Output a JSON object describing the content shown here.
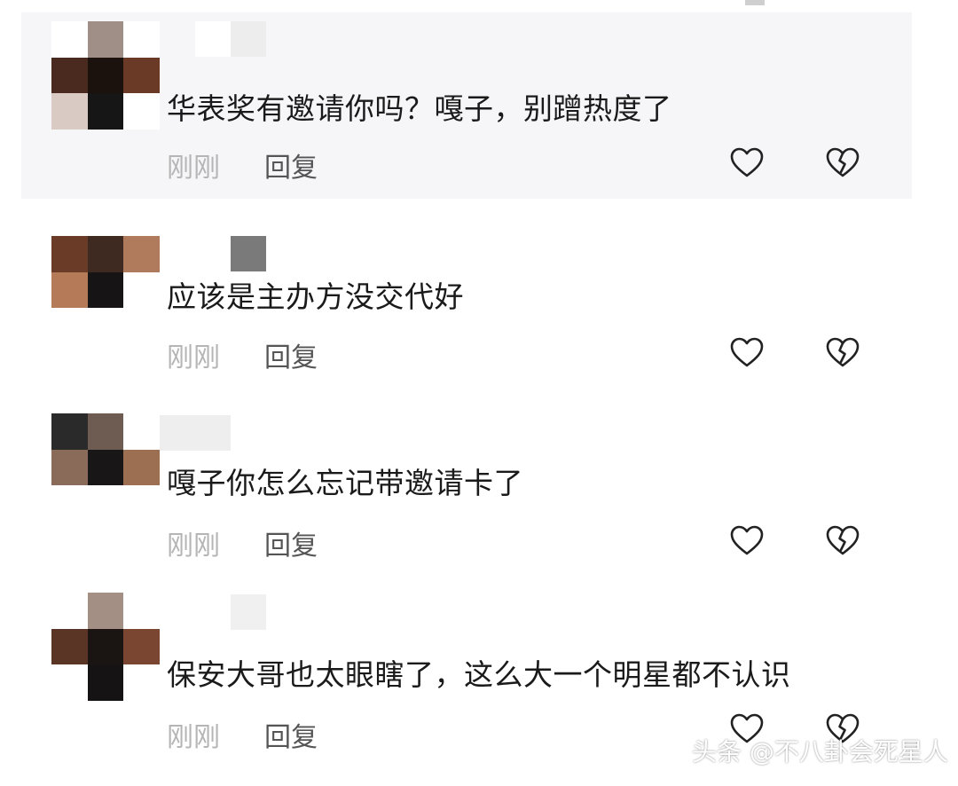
{
  "comments": [
    {
      "text": "华表奖有邀请你吗？嘎子，别蹭热度了",
      "time": "刚刚",
      "reply_label": "回复",
      "avatar_colors": [
        "#ffffff",
        "#a08f86",
        "#ffffff",
        "#4a2a1e",
        "#1b120e",
        "#6b3a27",
        "#d9cbc3",
        "#161616",
        "#ffffff"
      ],
      "username_colors": [
        "#ffffff",
        "#ededed"
      ]
    },
    {
      "text": "应该是主办方没交代好",
      "time": "刚刚",
      "reply_label": "回复",
      "avatar_colors": [
        "#6a3b26",
        "#3e2a20",
        "#b07a5c",
        "#b57a58",
        "#161414",
        "#ffffff",
        "#ffffff",
        "#ffffff",
        "#ffffff"
      ],
      "username_colors": [
        "#ffffff",
        "#7a7a7a"
      ]
    },
    {
      "text": "嘎子你怎么忘记带邀请卡了",
      "time": "刚刚",
      "reply_label": "回复",
      "avatar_colors": [
        "#2a2a2a",
        "#6e5c52",
        "#ffffff",
        "#8a6a58",
        "#181616",
        "#9c6e52",
        "#ffffff",
        "#ffffff",
        "#ffffff"
      ],
      "username_colors": [
        "#eeeeee",
        "#eeeeee"
      ]
    },
    {
      "text": "保安大哥也太眼瞎了，这么大一个明星都不认识",
      "time": "刚刚",
      "reply_label": "回复",
      "avatar_colors": [
        "#ffffff",
        "#a48f85",
        "#ffffff",
        "#5a3526",
        "#1a1412",
        "#7a4632",
        "#ffffff",
        "#151313",
        "#ffffff"
      ],
      "username_colors": [
        "#ffffff",
        "#f0f0f0"
      ]
    }
  ],
  "icons": {
    "like": "heart-icon",
    "dislike": "broken-heart-icon"
  },
  "watermark": "头条 @不八卦会死星人"
}
